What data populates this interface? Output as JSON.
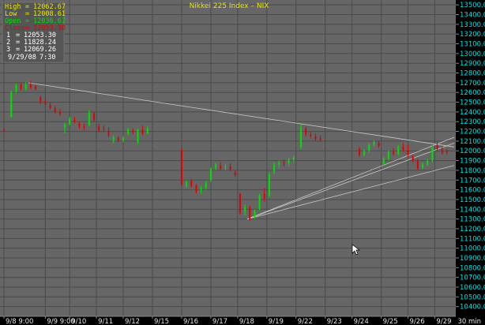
{
  "colors": {
    "background": "#000000",
    "plot_bg": "#666666",
    "grid": "#4a4a4a",
    "up_candle": "#00e000",
    "down_candle": "#e00000",
    "trendline": "#c8c8c8",
    "y_axis_text": "#00e0e0",
    "title_text": "#e8e800",
    "info_high": "#e8e800",
    "info_low": "#e8e800",
    "info_open": "#00e000",
    "info_close": "#e00000",
    "info_text": "#ffffff"
  },
  "info_box": {
    "high_label": "High",
    "high_value": "12062.67",
    "low_label": "Low",
    "low_value": "12008.61",
    "open_label": "Open",
    "open_value": "12036.67",
    "close_label": "Close",
    "close_value": "12053.30",
    "line1_label": "1",
    "line1_value": "12053.30",
    "line2_label": "2",
    "line2_value": "11828.24",
    "line3_label": "3",
    "line3_value": "12069.26",
    "date": "9/29/08",
    "time": "7:30"
  },
  "interval_label": "30 min",
  "chart_data": {
    "type": "candlestick",
    "title": "Nikkei 225 Index – NIX",
    "xlabel": "",
    "ylabel": "",
    "ylim": [
      10300,
      13550
    ],
    "yticks": [
      10400,
      10500,
      10600,
      10700,
      10800,
      10900,
      11000,
      11100,
      11200,
      11300,
      11400,
      11500,
      11600,
      11700,
      11800,
      11900,
      12000,
      12100,
      12200,
      12300,
      12400,
      12500,
      12600,
      12700,
      12800,
      12900,
      13000,
      13100,
      13200,
      13300,
      13400,
      13500
    ],
    "ytick_labels": [
      "10400.0",
      "10500.0",
      "10600.0",
      "10700.0",
      "10800.0",
      "10900.0",
      "11000.0",
      "11100.0",
      "11200.0",
      "11300.0",
      "11400.0",
      "11500.0",
      "11600.0",
      "11700.0",
      "11800.0",
      "11900.0",
      "12000.0",
      "12100.0",
      "12200.0",
      "12300.0",
      "12400.0",
      "12500.0",
      "12600.0",
      "12700.0",
      "12800.0",
      "12900.0",
      "13000.0",
      "13100.0",
      "13200.0",
      "13300.0",
      "13400.0",
      "13500.0"
    ],
    "x_count": 185,
    "xticks": [
      {
        "i": 0,
        "label": "9/8 9:00"
      },
      {
        "i": 17,
        "label": "9/9 9:00"
      },
      {
        "i": 27,
        "label": "9/10"
      },
      {
        "i": 38,
        "label": "9/11"
      },
      {
        "i": 49,
        "label": "9/12"
      },
      {
        "i": 61,
        "label": "9/15"
      },
      {
        "i": 73,
        "label": "9/16"
      },
      {
        "i": 85,
        "label": "9/17"
      },
      {
        "i": 96,
        "label": "9/18"
      },
      {
        "i": 108,
        "label": "9/19"
      },
      {
        "i": 120,
        "label": "9/22"
      },
      {
        "i": 132,
        "label": "9/23"
      },
      {
        "i": 143,
        "label": "9/24"
      },
      {
        "i": 155,
        "label": "9/25"
      },
      {
        "i": 166,
        "label": "9/26"
      },
      {
        "i": 177,
        "label": "9/29"
      }
    ],
    "grid": true,
    "legend": "none",
    "candles": [
      {
        "i": 0,
        "o": 12220,
        "h": 12230,
        "l": 12200,
        "c": 12210
      },
      {
        "i": 3,
        "o": 12350,
        "h": 12620,
        "l": 12340,
        "c": 12610
      },
      {
        "i": 5,
        "o": 12610,
        "h": 12690,
        "l": 12590,
        "c": 12670
      },
      {
        "i": 7,
        "o": 12680,
        "h": 12700,
        "l": 12620,
        "c": 12640
      },
      {
        "i": 9,
        "o": 12640,
        "h": 12710,
        "l": 12620,
        "c": 12680
      },
      {
        "i": 11,
        "o": 12680,
        "h": 12720,
        "l": 12630,
        "c": 12650
      },
      {
        "i": 13,
        "o": 12660,
        "h": 12680,
        "l": 12620,
        "c": 12640
      },
      {
        "i": 15,
        "o": 12550,
        "h": 12570,
        "l": 12480,
        "c": 12500
      },
      {
        "i": 17,
        "o": 12510,
        "h": 12540,
        "l": 12460,
        "c": 12480
      },
      {
        "i": 19,
        "o": 12470,
        "h": 12500,
        "l": 12420,
        "c": 12440
      },
      {
        "i": 21,
        "o": 12440,
        "h": 12460,
        "l": 12380,
        "c": 12400
      },
      {
        "i": 23,
        "o": 12400,
        "h": 12430,
        "l": 12360,
        "c": 12380
      },
      {
        "i": 25,
        "o": 12240,
        "h": 12290,
        "l": 12180,
        "c": 12270
      },
      {
        "i": 27,
        "o": 12280,
        "h": 12350,
        "l": 12260,
        "c": 12330
      },
      {
        "i": 29,
        "o": 12320,
        "h": 12350,
        "l": 12280,
        "c": 12300
      },
      {
        "i": 31,
        "o": 12280,
        "h": 12300,
        "l": 12230,
        "c": 12250
      },
      {
        "i": 33,
        "o": 12250,
        "h": 12280,
        "l": 12210,
        "c": 12240
      },
      {
        "i": 35,
        "o": 12260,
        "h": 12420,
        "l": 12250,
        "c": 12400
      },
      {
        "i": 37,
        "o": 12380,
        "h": 12400,
        "l": 12300,
        "c": 12320
      },
      {
        "i": 39,
        "o": 12250,
        "h": 12280,
        "l": 12190,
        "c": 12210
      },
      {
        "i": 41,
        "o": 12230,
        "h": 12260,
        "l": 12190,
        "c": 12220
      },
      {
        "i": 43,
        "o": 12200,
        "h": 12240,
        "l": 12140,
        "c": 12160
      },
      {
        "i": 45,
        "o": 12100,
        "h": 12160,
        "l": 12080,
        "c": 12140
      },
      {
        "i": 47,
        "o": 12130,
        "h": 12150,
        "l": 12090,
        "c": 12110
      },
      {
        "i": 49,
        "o": 12110,
        "h": 12150,
        "l": 12090,
        "c": 12130
      },
      {
        "i": 51,
        "o": 12170,
        "h": 12240,
        "l": 12160,
        "c": 12220
      },
      {
        "i": 53,
        "o": 12200,
        "h": 12230,
        "l": 12170,
        "c": 12190
      },
      {
        "i": 55,
        "o": 12090,
        "h": 12230,
        "l": 12070,
        "c": 12220
      },
      {
        "i": 57,
        "o": 12220,
        "h": 12260,
        "l": 12160,
        "c": 12180
      },
      {
        "i": 59,
        "o": 12180,
        "h": 12250,
        "l": 12170,
        "c": 12230
      },
      {
        "i": 73,
        "o": 12010,
        "h": 12030,
        "l": 11640,
        "c": 11660
      },
      {
        "i": 75,
        "o": 11640,
        "h": 11700,
        "l": 11620,
        "c": 11680
      },
      {
        "i": 77,
        "o": 11690,
        "h": 11710,
        "l": 11620,
        "c": 11640
      },
      {
        "i": 79,
        "o": 11640,
        "h": 11660,
        "l": 11560,
        "c": 11580
      },
      {
        "i": 81,
        "o": 11600,
        "h": 11640,
        "l": 11560,
        "c": 11620
      },
      {
        "i": 83,
        "o": 11620,
        "h": 11690,
        "l": 11600,
        "c": 11670
      },
      {
        "i": 85,
        "o": 11700,
        "h": 11830,
        "l": 11680,
        "c": 11810
      },
      {
        "i": 87,
        "o": 11820,
        "h": 11880,
        "l": 11800,
        "c": 11860
      },
      {
        "i": 89,
        "o": 11850,
        "h": 11880,
        "l": 11800,
        "c": 11820
      },
      {
        "i": 91,
        "o": 11830,
        "h": 11870,
        "l": 11800,
        "c": 11840
      },
      {
        "i": 93,
        "o": 11840,
        "h": 11870,
        "l": 11790,
        "c": 11810
      },
      {
        "i": 95,
        "o": 11780,
        "h": 11800,
        "l": 11730,
        "c": 11750
      },
      {
        "i": 97,
        "o": 11560,
        "h": 11570,
        "l": 11340,
        "c": 11360
      },
      {
        "i": 99,
        "o": 11380,
        "h": 11450,
        "l": 11340,
        "c": 11420
      },
      {
        "i": 101,
        "o": 11420,
        "h": 11440,
        "l": 11280,
        "c": 11300
      },
      {
        "i": 103,
        "o": 11320,
        "h": 11400,
        "l": 11300,
        "c": 11380
      },
      {
        "i": 105,
        "o": 11400,
        "h": 11560,
        "l": 11390,
        "c": 11540
      },
      {
        "i": 107,
        "o": 11560,
        "h": 11620,
        "l": 11480,
        "c": 11510
      },
      {
        "i": 109,
        "o": 11540,
        "h": 11780,
        "l": 11520,
        "c": 11760
      },
      {
        "i": 111,
        "o": 11790,
        "h": 11880,
        "l": 11760,
        "c": 11860
      },
      {
        "i": 113,
        "o": 11860,
        "h": 11900,
        "l": 11820,
        "c": 11880
      },
      {
        "i": 115,
        "o": 11880,
        "h": 11910,
        "l": 11840,
        "c": 11870
      },
      {
        "i": 117,
        "o": 11870,
        "h": 11930,
        "l": 11840,
        "c": 11910
      },
      {
        "i": 119,
        "o": 11910,
        "h": 11950,
        "l": 11880,
        "c": 11930
      },
      {
        "i": 122,
        "o": 12040,
        "h": 12270,
        "l": 12020,
        "c": 12240
      },
      {
        "i": 124,
        "o": 12230,
        "h": 12250,
        "l": 12150,
        "c": 12170
      },
      {
        "i": 126,
        "o": 12170,
        "h": 12200,
        "l": 12130,
        "c": 12150
      },
      {
        "i": 128,
        "o": 12150,
        "h": 12180,
        "l": 12100,
        "c": 12120
      },
      {
        "i": 130,
        "o": 12130,
        "h": 12160,
        "l": 12090,
        "c": 12110
      },
      {
        "i": 146,
        "o": 12020,
        "h": 12040,
        "l": 11940,
        "c": 11960
      },
      {
        "i": 148,
        "o": 11960,
        "h": 12020,
        "l": 11940,
        "c": 12000
      },
      {
        "i": 150,
        "o": 12000,
        "h": 12080,
        "l": 11980,
        "c": 12060
      },
      {
        "i": 152,
        "o": 12060,
        "h": 12110,
        "l": 12040,
        "c": 12090
      },
      {
        "i": 154,
        "o": 12080,
        "h": 12100,
        "l": 12030,
        "c": 12050
      },
      {
        "i": 156,
        "o": 11860,
        "h": 11940,
        "l": 11850,
        "c": 11920
      },
      {
        "i": 158,
        "o": 11920,
        "h": 12010,
        "l": 11900,
        "c": 11990
      },
      {
        "i": 160,
        "o": 11990,
        "h": 12030,
        "l": 11950,
        "c": 11970
      },
      {
        "i": 162,
        "o": 11970,
        "h": 12060,
        "l": 11950,
        "c": 12040
      },
      {
        "i": 164,
        "o": 12040,
        "h": 12080,
        "l": 11990,
        "c": 12010
      },
      {
        "i": 166,
        "o": 12010,
        "h": 12060,
        "l": 11940,
        "c": 11960
      },
      {
        "i": 168,
        "o": 11940,
        "h": 11960,
        "l": 11880,
        "c": 11900
      },
      {
        "i": 170,
        "o": 11900,
        "h": 11920,
        "l": 11800,
        "c": 11820
      },
      {
        "i": 172,
        "o": 11830,
        "h": 11880,
        "l": 11810,
        "c": 11860
      },
      {
        "i": 174,
        "o": 11860,
        "h": 11920,
        "l": 11840,
        "c": 11900
      },
      {
        "i": 176,
        "o": 11900,
        "h": 12060,
        "l": 11880,
        "c": 12040
      },
      {
        "i": 178,
        "o": 12060,
        "h": 12090,
        "l": 11990,
        "c": 12020
      },
      {
        "i": 180,
        "o": 12020,
        "h": 12050,
        "l": 11960,
        "c": 11980
      },
      {
        "i": 182,
        "o": 12000,
        "h": 12020,
        "l": 11960,
        "c": 11990
      }
    ],
    "trendlines": [
      {
        "i1": 10,
        "v1": 12700,
        "i2": 185,
        "v2": 12040
      },
      {
        "i1": 100,
        "v1": 11300,
        "i2": 185,
        "v2": 12140
      },
      {
        "i1": 100,
        "v1": 11300,
        "i2": 185,
        "v2": 12080
      },
      {
        "i1": 100,
        "v1": 11300,
        "i2": 185,
        "v2": 11850
      }
    ]
  }
}
